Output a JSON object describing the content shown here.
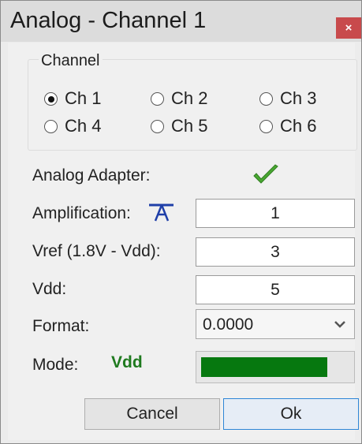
{
  "window": {
    "title": "Analog - Channel 1",
    "close_label": "×"
  },
  "channel_group": {
    "legend": "Channel",
    "options": [
      "Ch 1",
      "Ch 2",
      "Ch 3",
      "Ch 4",
      "Ch 5",
      "Ch 6"
    ],
    "selected": "Ch 1"
  },
  "analog_adapter": {
    "label": "Analog Adapter:",
    "status_icon": "checkmark-icon",
    "status_color": "#4aa832"
  },
  "amplification": {
    "label": "Amplification:",
    "icon": "antenna-icon",
    "value": "1"
  },
  "vref": {
    "label": "Vref (1.8V - Vdd):",
    "value": "3"
  },
  "vdd": {
    "label": "Vdd:",
    "value": "5"
  },
  "format": {
    "label": "Format:",
    "selected": "0.0000"
  },
  "mode": {
    "label": "Mode:",
    "value": "Vdd",
    "value_color": "#1f7a1f",
    "level_fraction": 0.85,
    "bar_color": "#06780f"
  },
  "buttons": {
    "cancel": "Cancel",
    "ok": "Ok"
  }
}
